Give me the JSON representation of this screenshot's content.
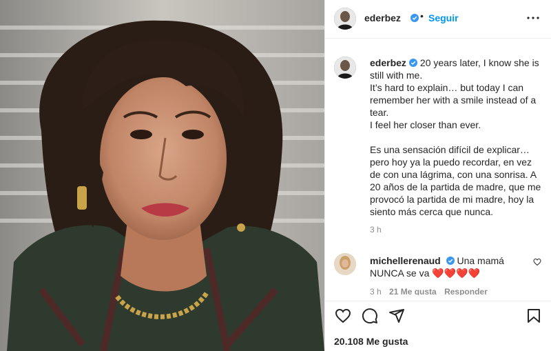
{
  "photo": {
    "subject": "portrait"
  },
  "header": {
    "username": "ederbez",
    "verified": true,
    "separator": "•",
    "follow_label": "Seguir",
    "more_icon": "ellipsis-icon"
  },
  "caption": {
    "username": "ederbez",
    "verified": true,
    "text": "20 years later, I know she is still with me.\nIt’s hard to explain… but today I can remember her with a smile instead of a tear.\nI feel her closer than ever.\n\nEs una sensación difícil de explicar… pero hoy ya la puedo recordar, en vez de con una lágrima, con una sonrisa. A 20 años de la partida de madre, que me provocó la partida de mi madre, hoy la siento más cerca que nunca.",
    "time": "3 h"
  },
  "comment": {
    "username": "michellerenaud",
    "verified": true,
    "text": "Una mamá NUNCA se va",
    "hearts": "❤️❤️❤️❤️",
    "time": "3 h",
    "likes": "21 Me gusta",
    "reply_label": "Responder"
  },
  "actions": {
    "icons": [
      "heart-icon",
      "comment-icon",
      "share-icon",
      "bookmark-icon"
    ],
    "likes_text": "20.108 Me gusta"
  },
  "colors": {
    "accent": "#0095f6",
    "verified": "#3897f0",
    "heart": "#e0243a"
  }
}
